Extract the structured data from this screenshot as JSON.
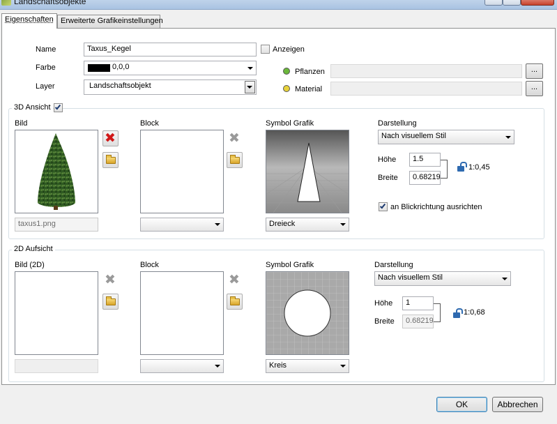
{
  "window": {
    "title": "Landschaftsobjekte"
  },
  "tabs": [
    {
      "label": "Eigenschaften",
      "active": true
    },
    {
      "label": "Erweiterte Grafikeinstellungen",
      "active": false
    }
  ],
  "general": {
    "name_label": "Name",
    "name_value": "Taxus_Kegel",
    "anzeigen_label": "Anzeigen",
    "anzeigen_checked": false,
    "farbe_label": "Farbe",
    "farbe_value": "0,0,0",
    "farbe_swatch": "#000000",
    "layer_label": "Layer",
    "layer_value": "Landschaftsobjekt",
    "pflanzen_label": "Pflanzen",
    "pflanzen_dot_color": "#6bb83a",
    "material_label": "Material",
    "material_dot_color": "#e8d23a",
    "browse_label": "..."
  },
  "view3d": {
    "group_label": "3D Ansicht",
    "enabled": true,
    "bild_label": "Bild",
    "bild_file": "taxus1.png",
    "block_label": "Block",
    "block_value": "",
    "symbol_label": "Symbol Grafik",
    "symbol_value": "Dreieck",
    "darstellung_label": "Darstellung",
    "darstellung_value": "Nach visuellem Stil",
    "hoehe_label": "Höhe",
    "hoehe_value": "1.5",
    "breite_label": "Breite",
    "breite_value": "0.68219",
    "ratio": "1:0,45",
    "align_label": "an Blickrichtung ausrichten",
    "align_checked": true
  },
  "view2d": {
    "group_label": "2D Aufsicht",
    "bild_label": "Bild (2D)",
    "block_label": "Block",
    "block_value": "",
    "symbol_label": "Symbol Grafik",
    "symbol_value": "Kreis",
    "darstellung_label": "Darstellung",
    "darstellung_value": "Nach visuellem Stil",
    "hoehe_label": "Höhe",
    "hoehe_value": "1",
    "breite_label": "Breite",
    "breite_value": "0.68219",
    "ratio": "1:0,68"
  },
  "footer": {
    "ok_label": "OK",
    "cancel_label": "Abbrechen"
  },
  "icons": {
    "delete": "x-icon",
    "open": "folder-icon",
    "lock": "lock-icon",
    "dropdown": "chevron-down-icon"
  },
  "colors": {
    "delete_active": "#d01818",
    "delete_disabled": "#9a9a9a"
  }
}
